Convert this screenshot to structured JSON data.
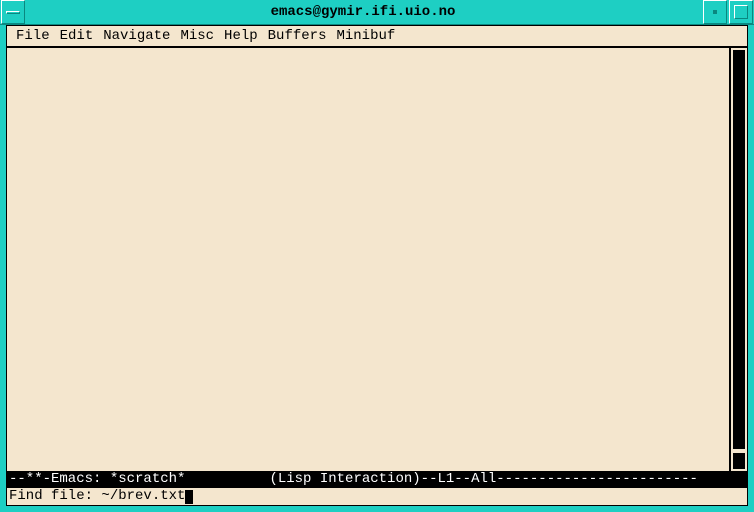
{
  "titlebar": {
    "title": "emacs@gymir.ifi.uio.no"
  },
  "menubar": {
    "items": [
      {
        "label": "File"
      },
      {
        "label": "Edit"
      },
      {
        "label": "Navigate"
      },
      {
        "label": "Misc"
      },
      {
        "label": "Help"
      },
      {
        "label": "Buffers"
      },
      {
        "label": "Minibuf"
      }
    ]
  },
  "modeline": {
    "text": "--**-Emacs: *scratch*          (Lisp Interaction)--L1--All------------------------"
  },
  "minibuffer": {
    "prompt": "Find file: ",
    "input": "~/brev.txt"
  }
}
